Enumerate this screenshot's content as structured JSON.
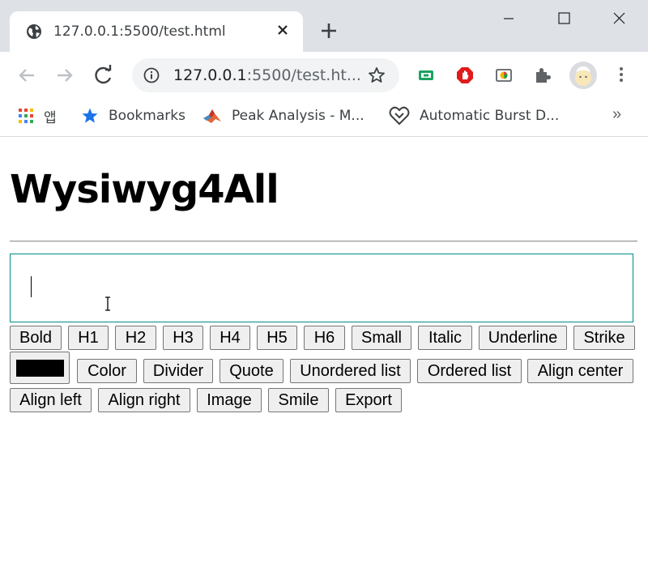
{
  "browser": {
    "tab": {
      "title": "127.0.0.1:5500/test.html"
    },
    "address": {
      "host": "127.0.0.1",
      "rest": ":5500/test.ht..."
    },
    "bookmarks": {
      "apps_label": "앱",
      "items": [
        "Bookmarks",
        "Peak Analysis - M...",
        "Automatic Burst D..."
      ],
      "more": "»"
    }
  },
  "page": {
    "title": "Wysiwyg4All",
    "editor": {
      "content": ""
    },
    "color_value": "#000000",
    "buttons_row1": [
      "Bold",
      "H1",
      "H2",
      "H3",
      "H4",
      "H5",
      "H6",
      "Small",
      "Italic",
      "Underline",
      "Strike"
    ],
    "buttons_row2": [
      "Color",
      "Divider",
      "Quote",
      "Unordered list",
      "Ordered list",
      "Align center"
    ],
    "buttons_row3": [
      "Align left",
      "Align right",
      "Image",
      "Smile",
      "Export"
    ]
  }
}
